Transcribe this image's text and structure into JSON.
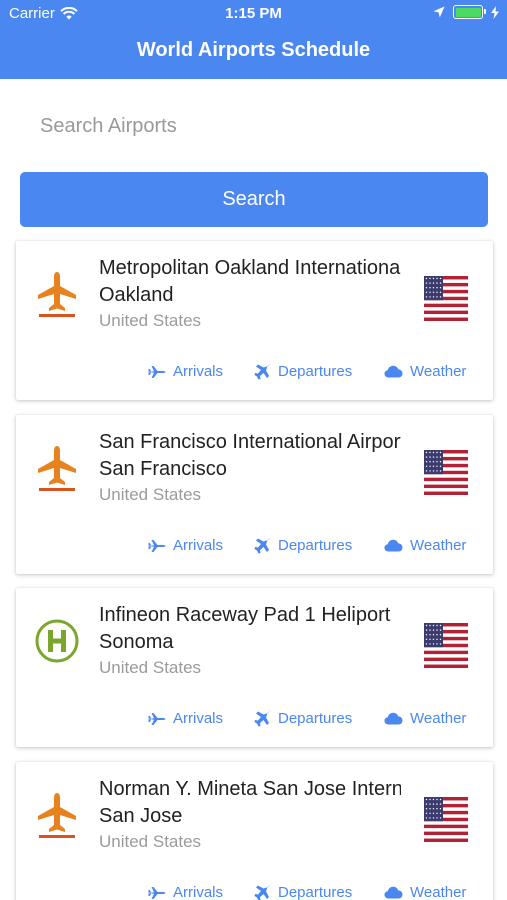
{
  "status_bar": {
    "carrier": "Carrier",
    "time": "1:15 PM"
  },
  "header": {
    "title": "World Airports Schedule",
    "color": "#4a87f1"
  },
  "search": {
    "placeholder": "Search Airports",
    "value": "",
    "button_label": "Search"
  },
  "airports": [
    {
      "name": "Metropolitan Oakland International Airport",
      "city": "Oakland",
      "country": "United States",
      "type_icon": "airport-icon",
      "flag_icon": "us-flag-icon",
      "actions": {
        "arrivals": "Arrivals",
        "departures": "Departures",
        "weather": "Weather"
      }
    },
    {
      "name": "San Francisco International Airport",
      "city": "San Francisco",
      "country": "United States",
      "type_icon": "airport-icon",
      "flag_icon": "us-flag-icon",
      "actions": {
        "arrivals": "Arrivals",
        "departures": "Departures",
        "weather": "Weather"
      }
    },
    {
      "name": "Infineon Raceway Pad 1 Heliport",
      "city": "Sonoma",
      "country": "United States",
      "type_icon": "heliport-icon",
      "flag_icon": "us-flag-icon",
      "actions": {
        "arrivals": "Arrivals",
        "departures": "Departures",
        "weather": "Weather"
      }
    },
    {
      "name": "Norman Y. Mineta San Jose International Airport",
      "city": "San Jose",
      "country": "United States",
      "type_icon": "airport-icon",
      "flag_icon": "us-flag-icon",
      "actions": {
        "arrivals": "Arrivals",
        "departures": "Departures",
        "weather": "Weather"
      }
    }
  ],
  "colors": {
    "accent": "#4a87f1",
    "airport_icon": "#e8821e",
    "heliport_icon": "#7aa62e",
    "battery": "#4cd964"
  }
}
